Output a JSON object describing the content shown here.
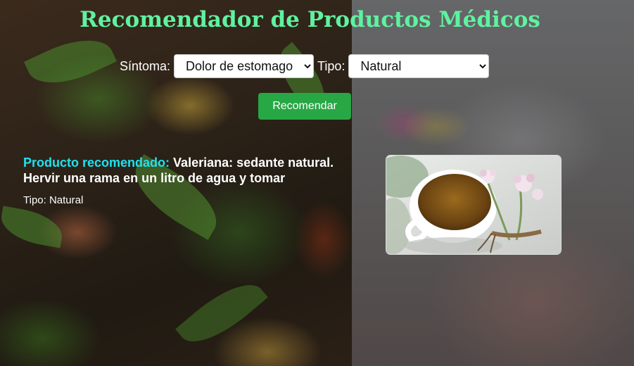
{
  "header": {
    "title": "Recomendador de Productos Médicos"
  },
  "form": {
    "symptom_label": "Síntoma:",
    "symptom_selected": "Dolor de estomago",
    "type_label": "Tipo:",
    "type_selected": "Natural",
    "button_label": "Recomendar"
  },
  "result": {
    "label": "Producto recomendado:",
    "product": "Valeriana: sedante natural. Hervir una rama en un litro de agua y tomar",
    "type_line": "Tipo: Natural",
    "image_icon": "valerian-tea-photo"
  },
  "colors": {
    "title": "#5ff2a0",
    "label": "#1de2f0",
    "button": "#28a745"
  }
}
